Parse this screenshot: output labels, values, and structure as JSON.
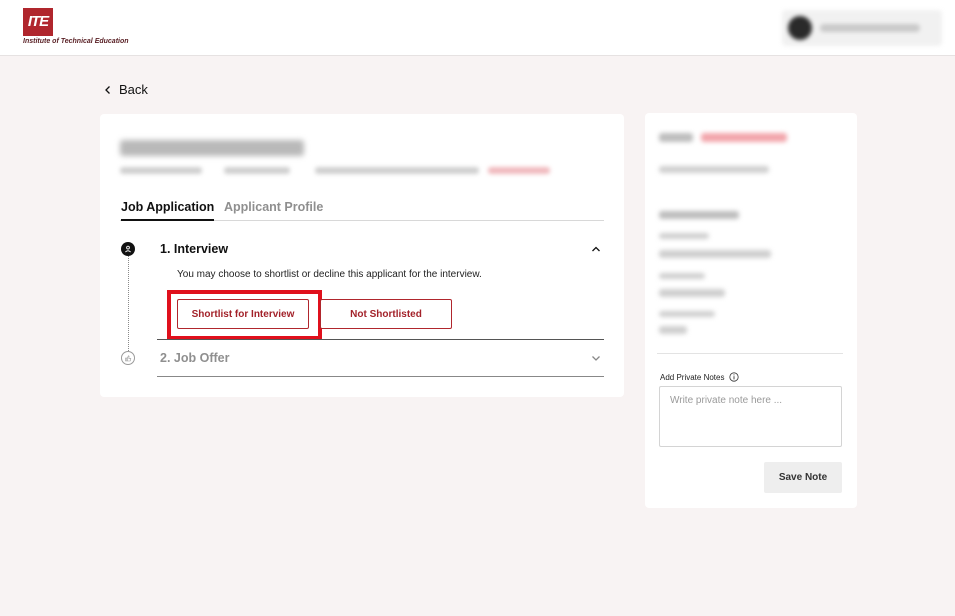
{
  "header": {
    "logo_mark": "ITE",
    "logo_subtitle": "Institute of Technical Education"
  },
  "nav": {
    "back_label": "Back"
  },
  "tabs": [
    {
      "label": "Job Application",
      "active": true
    },
    {
      "label": "Applicant Profile",
      "active": false
    }
  ],
  "steps": [
    {
      "title": "1. Interview",
      "expanded": true,
      "description": "You may choose to shortlist or decline this applicant for the interview.",
      "actions": {
        "shortlist_label": "Shortlist for Interview",
        "decline_label": "Not Shortlisted"
      }
    },
    {
      "title": "2. Job Offer",
      "expanded": false
    }
  ],
  "side_panel": {
    "notes_label": "Add Private Notes",
    "notes_placeholder": "Write private note here ...",
    "save_label": "Save Note"
  },
  "colors": {
    "brand": "#b0262d",
    "highlight": "#e0101c",
    "page_bg": "#f8f3f3"
  }
}
